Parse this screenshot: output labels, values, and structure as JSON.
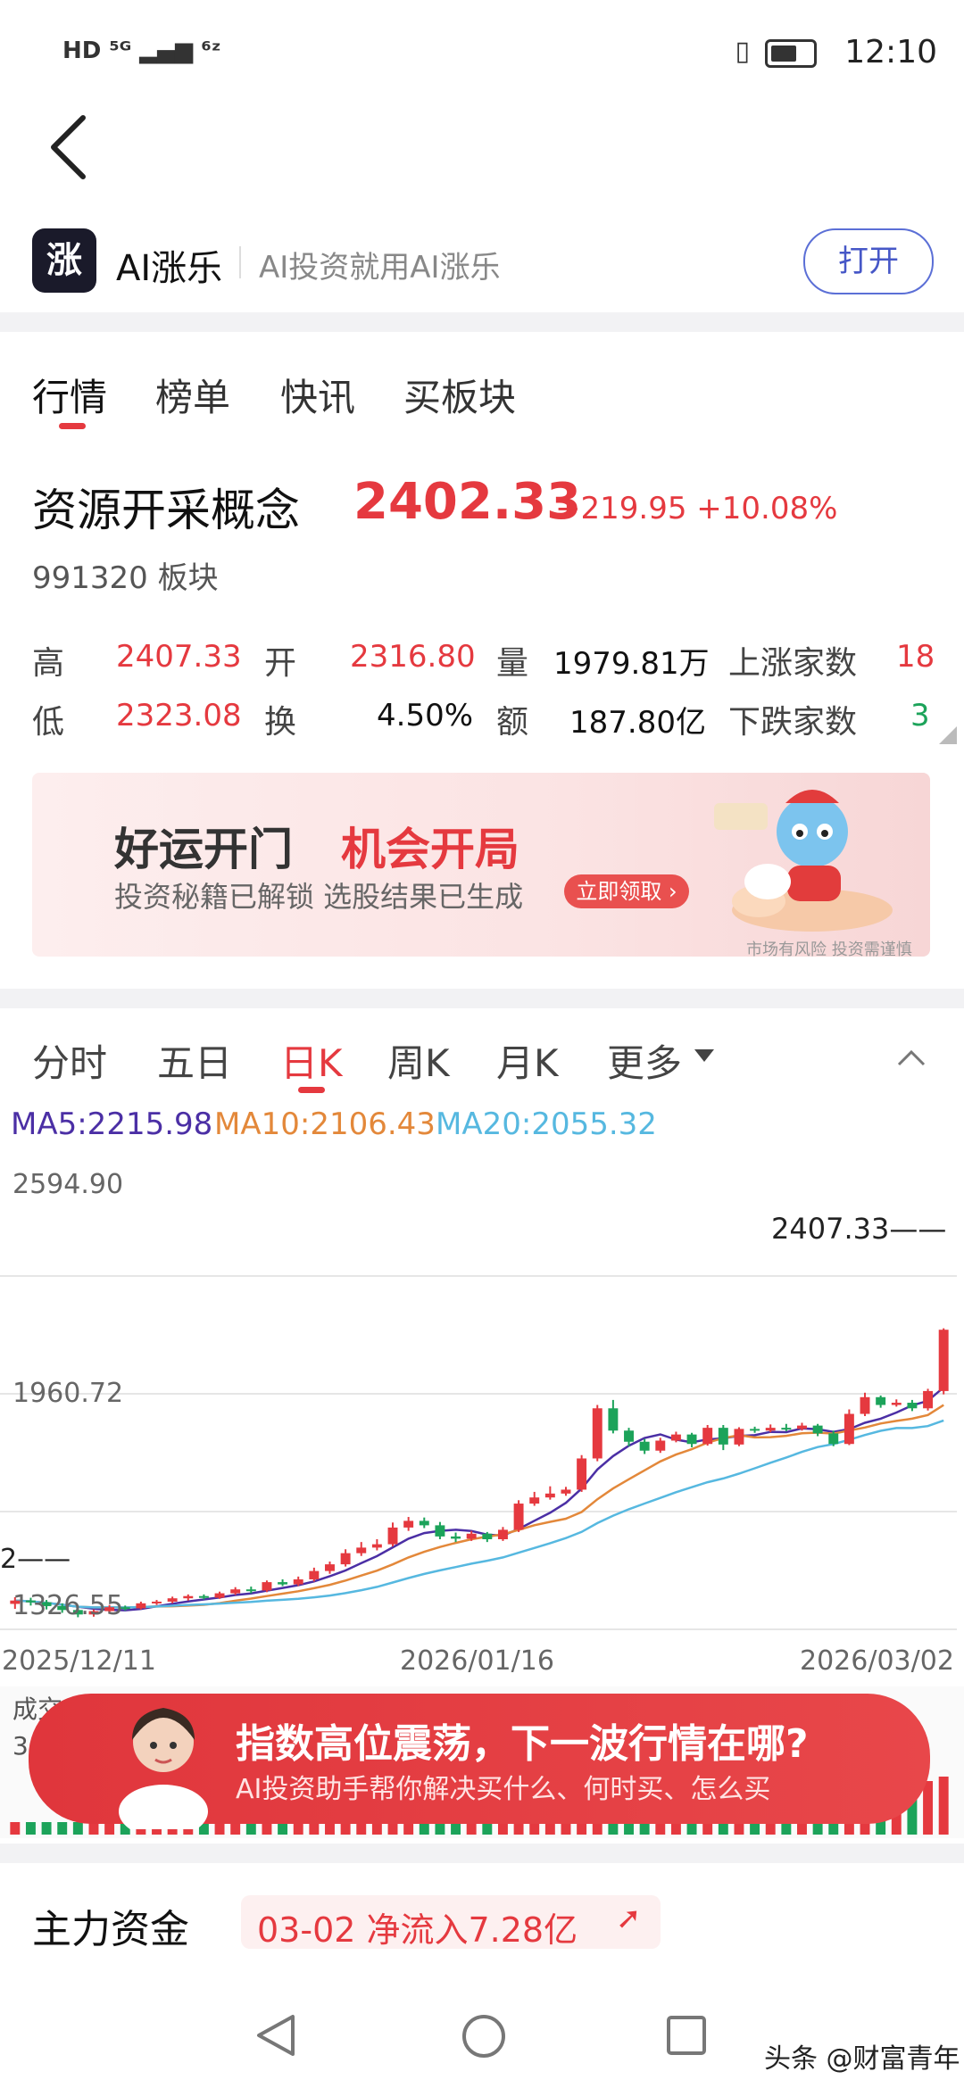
{
  "status_bar": {
    "left": "HD ⁵ᴳ ▂▄▆ ⁶ᶻ",
    "time": "12:10"
  },
  "app": {
    "logo": "涨",
    "name": "AI涨乐",
    "slogan": "AI投资就用AI涨乐",
    "open_label": "打开"
  },
  "tabs": [
    "行情",
    "榜单",
    "快讯",
    "买板块"
  ],
  "quote": {
    "name": "资源开采概念",
    "price": "2402.33",
    "change": "+219.95 +10.08%",
    "code": "991320 板块",
    "stats": [
      {
        "l1": "高",
        "v1": "2407.33",
        "l2": "开",
        "v2": "2316.80",
        "l3": "量",
        "v3": "1979.81万",
        "l4": "上涨家数",
        "v4": "18"
      },
      {
        "l1": "低",
        "v1": "2323.08",
        "l2": "换",
        "v2": "4.50%",
        "l3": "额",
        "v3": "187.80亿",
        "l4": "下跌家数",
        "v4": "3"
      }
    ]
  },
  "banner": {
    "title_a": "好运开门",
    "title_b": "机会开局",
    "subtitle": "投资秘籍已解锁 选股结果已生成",
    "button": "立即领取 ›",
    "risk": "市场有风险 投资需谨慎"
  },
  "chart_tabs": [
    "分时",
    "五日",
    "日K",
    "周K",
    "月K",
    "更多"
  ],
  "ma": {
    "ma5": "MA5:2215.98",
    "ma10": "MA10:2106.43",
    "ma20": "MA20:2055.32"
  },
  "colors": {
    "up": "#e5393f",
    "down": "#1ca35a",
    "ma5": "#4b2fa5",
    "ma10": "#e3883a",
    "ma20": "#56b8e0",
    "accent": "#4657c7"
  },
  "chart_data": {
    "type": "candlestick",
    "y_labels": [
      "2594.90",
      "1960.72",
      "1326.55"
    ],
    "x_labels": [
      "2025/12/11",
      "2026/01/16",
      "2026/03/02"
    ],
    "max_label": "2407.33",
    "min_label": "2",
    "ylim": [
      1326.55,
      2594.9
    ],
    "candles": [
      [
        1418,
        1430,
        1400,
        1442
      ],
      [
        1430,
        1424,
        1412,
        1440
      ],
      [
        1424,
        1410,
        1398,
        1432
      ],
      [
        1410,
        1396,
        1386,
        1420
      ],
      [
        1396,
        1380,
        1370,
        1404
      ],
      [
        1380,
        1392,
        1372,
        1398
      ],
      [
        1392,
        1406,
        1386,
        1414
      ],
      [
        1406,
        1402,
        1394,
        1412
      ],
      [
        1402,
        1420,
        1398,
        1426
      ],
      [
        1420,
        1426,
        1414,
        1432
      ],
      [
        1426,
        1438,
        1420,
        1444
      ],
      [
        1438,
        1446,
        1430,
        1452
      ],
      [
        1446,
        1440,
        1434,
        1452
      ],
      [
        1440,
        1456,
        1436,
        1462
      ],
      [
        1456,
        1470,
        1450,
        1478
      ],
      [
        1470,
        1466,
        1456,
        1480
      ],
      [
        1466,
        1496,
        1460,
        1502
      ],
      [
        1496,
        1488,
        1482,
        1506
      ],
      [
        1488,
        1506,
        1482,
        1516
      ],
      [
        1506,
        1536,
        1498,
        1548
      ],
      [
        1536,
        1560,
        1526,
        1570
      ],
      [
        1560,
        1600,
        1552,
        1614
      ],
      [
        1600,
        1620,
        1590,
        1640
      ],
      [
        1620,
        1632,
        1610,
        1650
      ],
      [
        1632,
        1692,
        1624,
        1710
      ],
      [
        1692,
        1716,
        1680,
        1730
      ],
      [
        1716,
        1700,
        1690,
        1728
      ],
      [
        1700,
        1660,
        1650,
        1712
      ],
      [
        1660,
        1652,
        1640,
        1674
      ],
      [
        1652,
        1670,
        1644,
        1680
      ],
      [
        1670,
        1650,
        1640,
        1676
      ],
      [
        1650,
        1684,
        1644,
        1694
      ],
      [
        1684,
        1778,
        1676,
        1790
      ],
      [
        1778,
        1800,
        1770,
        1820
      ],
      [
        1800,
        1814,
        1792,
        1840
      ],
      [
        1814,
        1828,
        1806,
        1838
      ],
      [
        1828,
        1940,
        1820,
        1952
      ],
      [
        1940,
        2120,
        1930,
        2132
      ],
      [
        2120,
        2040,
        2030,
        2150
      ],
      [
        2040,
        2000,
        1984,
        2050
      ],
      [
        2000,
        1968,
        1956,
        2010
      ],
      [
        1968,
        2004,
        1960,
        2014
      ],
      [
        2004,
        2026,
        1998,
        2036
      ],
      [
        2026,
        1992,
        1980,
        2032
      ],
      [
        1992,
        2050,
        1986,
        2060
      ],
      [
        2050,
        1990,
        1970,
        2060
      ],
      [
        1990,
        2046,
        1984,
        2052
      ],
      [
        2046,
        2040,
        2032,
        2054
      ],
      [
        2040,
        2050,
        2034,
        2062
      ],
      [
        2050,
        2046,
        2038,
        2064
      ],
      [
        2046,
        2058,
        2040,
        2068
      ],
      [
        2058,
        2030,
        2020,
        2064
      ],
      [
        2030,
        1992,
        1984,
        2040
      ],
      [
        1992,
        2100,
        1988,
        2116
      ],
      [
        2100,
        2160,
        2092,
        2176
      ],
      [
        2160,
        2132,
        2122,
        2166
      ],
      [
        2132,
        2140,
        2126,
        2152
      ],
      [
        2140,
        2120,
        2110,
        2150
      ],
      [
        2120,
        2182,
        2112,
        2190
      ],
      [
        2182,
        2402,
        2170,
        2407
      ]
    ],
    "volume_label_a": "成交",
    "volume_label_b": "3"
  },
  "ad": {
    "title": "指数高位震荡，下一波行情在哪?",
    "subtitle": "AI投资助手帮你解决买什么、何时买、怎么买"
  },
  "capital": {
    "title": "主力资金",
    "value": "03-02 净流入7.28亿"
  },
  "watermark": "头条 @财富青年"
}
